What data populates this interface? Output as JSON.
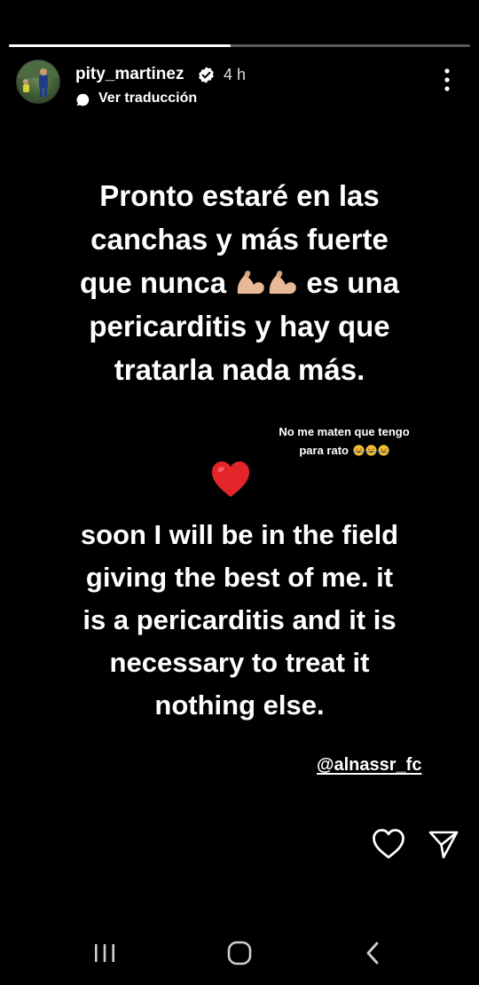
{
  "story": {
    "progress": 0.48,
    "username": "pity_martinez",
    "time": "4 h",
    "translate_label": "Ver traducción",
    "main_text": {
      "line1": "Pronto estaré en las",
      "line2": "canchas y más fuerte",
      "line3_before": "que nunca",
      "line3_after": "es una",
      "line4": "pericarditis y hay que",
      "line5": "tratarla nada más."
    },
    "small_note": {
      "line1": "No me maten que tengo",
      "line2": "para rato"
    },
    "english_text": {
      "line1": "soon I will be in the field",
      "line2": "giving the best of me.  it",
      "line3": "is a pericarditis and it is",
      "line4": "necessary to treat it",
      "line5": "nothing else."
    },
    "mention": "@alnassr_fc"
  },
  "icons": {
    "verified": "verified-badge-icon",
    "translate": "speech-bubble-icon",
    "more": "more-vertical-icon",
    "arm_emoji": "flexed-biceps-emoji",
    "laugh_emoji": "rolling-laughing-emoji",
    "heart_emoji": "red-heart-emoji",
    "like": "heart-outline-icon",
    "share": "paper-plane-icon",
    "nav_recents": "recents-icon",
    "nav_home": "home-icon",
    "nav_back": "back-icon"
  },
  "colors": {
    "background": "#000000",
    "text": "#ffffff",
    "heart": "#e3242b",
    "skin": "#e8b996"
  }
}
